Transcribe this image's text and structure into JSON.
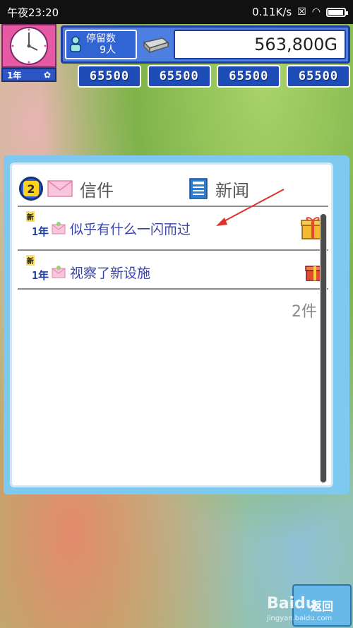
{
  "status_bar": {
    "time": "午夜23:20",
    "network_speed": "0.11K/s",
    "battery_percent": 95
  },
  "hud": {
    "year_label": "1年",
    "guest_label": "停留数",
    "guest_value": "9人",
    "money": "563,800G",
    "stats": [
      "65500",
      "65500",
      "65500",
      "65500"
    ]
  },
  "dialog": {
    "unread_count": "2",
    "tab_mail": "信件",
    "tab_news": "新闻",
    "items": [
      {
        "badge": "新",
        "year": "1年",
        "text": "似乎有什么一闪而过"
      },
      {
        "badge": "新",
        "year": "1年",
        "text": "视察了新设施"
      }
    ],
    "total": "2件"
  },
  "return_button": "返回",
  "watermark": {
    "brand": "Baidu",
    "sub": "jingyan.baidu.com"
  },
  "colors": {
    "accent": "#2a5fd6",
    "text_link": "#3944a8",
    "arrow": "#e0302a"
  }
}
